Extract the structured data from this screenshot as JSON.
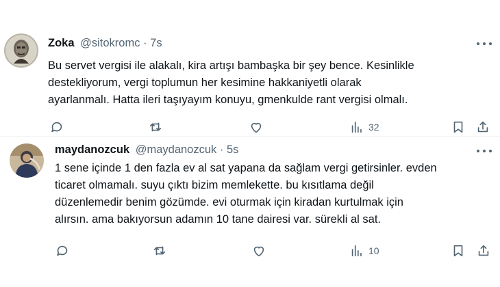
{
  "tweets": [
    {
      "name": "Zoka",
      "handle": "@sitokromc",
      "separator": "·",
      "time": "7s",
      "avatar_icon": "avatar-portrait-icon",
      "lines": [
        "Bu servet vergisi ile alakalı, kira artışı bambaşka bir şey bence. Kesinlikle",
        "destekliyorum, vergi toplumun her kesimine hakkaniyetli olarak",
        "ayarlanmalı. Hatta ileri taşıyayım konuyu, gmenkulde rant vergisi olmalı."
      ],
      "views": "32"
    },
    {
      "name": "maydanozcuk",
      "handle": "@maydanozcuk",
      "separator": "·",
      "time": "5s",
      "avatar_icon": "avatar-person-icon",
      "lines": [
        "1 sene içinde 1 den fazla ev al sat yapana da sağlam vergi getirsinler. evden",
        "ticaret olmamalı. suyu çıktı bizim memlekette. bu kısıtlama değil",
        "düzenlemedir benim gözümde. evi oturmak için kiradan kurtulmak için",
        "alırsın. ama bakıyorsun adamın 10 tane dairesi var. sürekli al sat."
      ],
      "views": "10"
    }
  ],
  "icons": {
    "reply": "reply-icon",
    "retweet": "retweet-icon",
    "like": "like-icon",
    "views": "views-icon",
    "bookmark": "bookmark-icon",
    "share": "share-icon",
    "more": "more-icon"
  },
  "colors": {
    "text": "#0f1419",
    "secondary": "#536471",
    "divider": "#eff3f4"
  }
}
